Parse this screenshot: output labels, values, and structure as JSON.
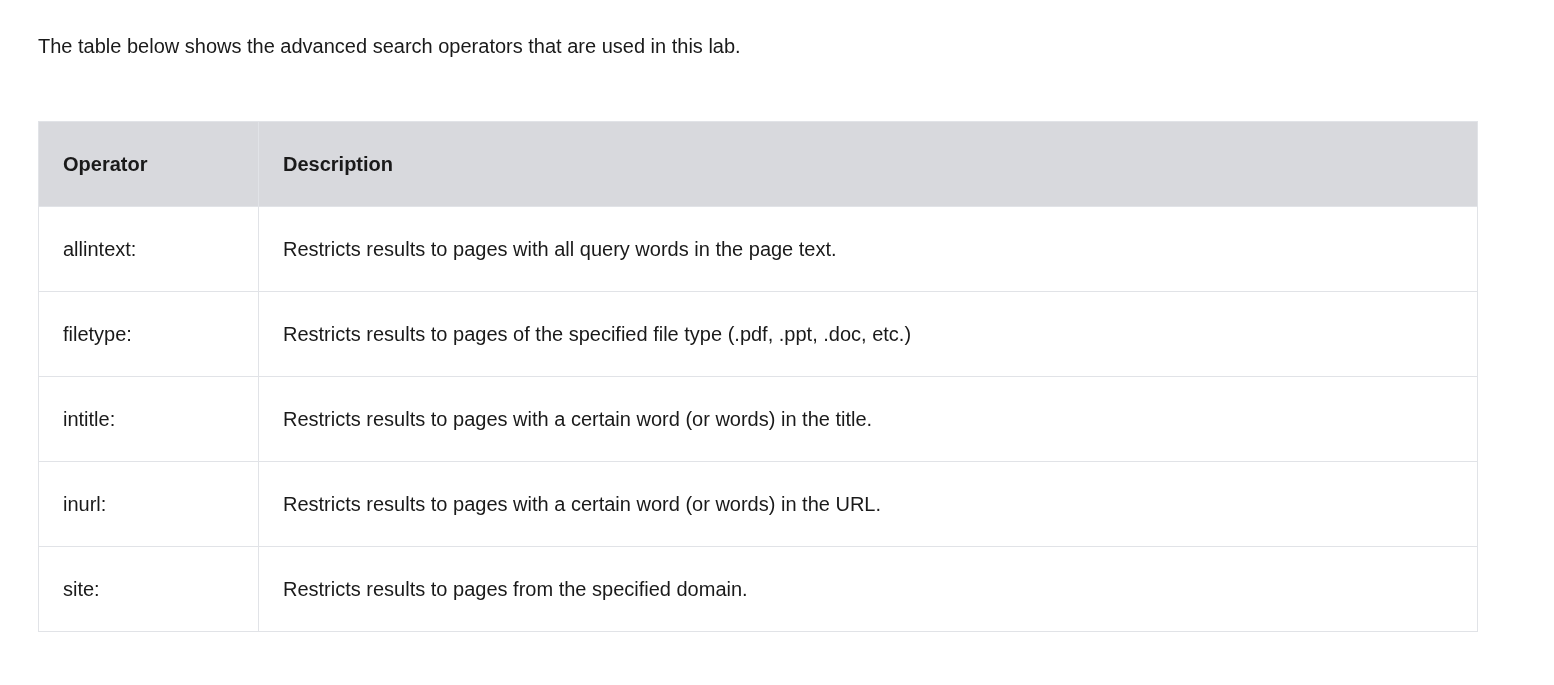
{
  "intro": "The table below shows the advanced search operators that are used in this lab.",
  "table": {
    "columns": [
      "Operator",
      "Description"
    ],
    "rows": [
      {
        "operator": "allintext:",
        "description": "Restricts results to pages with all query words in the page text."
      },
      {
        "operator": "filetype:",
        "description": "Restricts results to pages of the specified file type (.pdf, .ppt, .doc, etc.)"
      },
      {
        "operator": "intitle:",
        "description": "Restricts results to pages with a certain word (or words) in the title."
      },
      {
        "operator": "inurl:",
        "description": "Restricts results to pages with a certain word (or words) in the URL."
      },
      {
        "operator": "site:",
        "description": "Restricts results to pages from the specified domain."
      }
    ]
  }
}
